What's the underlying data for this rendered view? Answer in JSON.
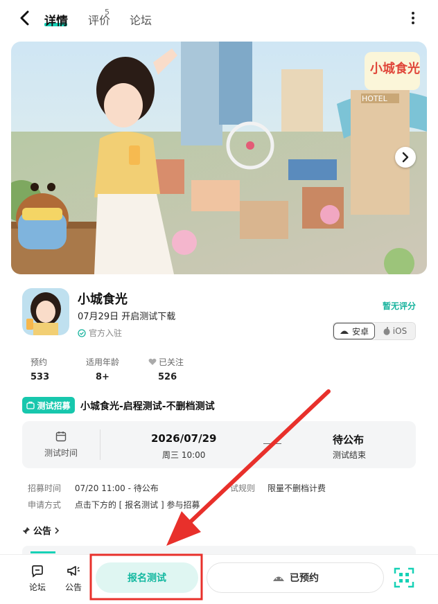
{
  "nav": {
    "tabs": [
      {
        "label": "详情",
        "active": true
      },
      {
        "label": "评价",
        "badge": "5"
      },
      {
        "label": "论坛"
      }
    ]
  },
  "banner": {
    "logo_text": "小城食光",
    "hotel_sign": "HOTEL"
  },
  "game": {
    "name": "小城食光",
    "subtitle": "07月29日 开启测试下载",
    "official": "官方入驻",
    "rating": "暂无评分",
    "platforms": [
      {
        "label": "安卓",
        "icon": "android-icon",
        "active": true
      },
      {
        "label": "iOS",
        "icon": "apple-icon",
        "active": false
      }
    ]
  },
  "stats": [
    {
      "label": "预约",
      "value": "533"
    },
    {
      "label": "适用年龄",
      "value": "8+"
    },
    {
      "label": "已关注",
      "value": "526"
    }
  ],
  "recruit": {
    "tag": "测试招募",
    "title": "小城食光-启程测试-不删档测试",
    "test_time_label": "测试时间",
    "start_date": "2026/07/29",
    "start_day": "周三 10:00",
    "end_value": "待公布",
    "end_label": "测试结束",
    "recruit_time_key": "招募时间",
    "recruit_time_value": "07/20 11:00 - 待公布",
    "apply_key": "申请方式",
    "apply_value": "点击下方的 [ 报名测试 ] 参与招募",
    "rule_label": "试规则",
    "rule_value": "限量不删档计费"
  },
  "notice": {
    "label": "公告"
  },
  "bottom": {
    "forum": "论坛",
    "announce": "公告",
    "signup": "报名测试",
    "reserved": "已预约"
  },
  "colors": {
    "accent": "#17d1b6",
    "annotation": "#e8302b"
  }
}
